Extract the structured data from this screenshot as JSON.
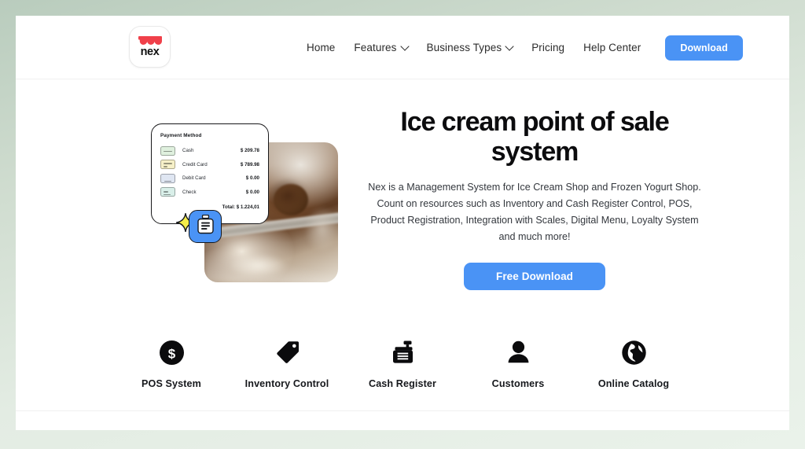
{
  "brand": {
    "logo_word": "nex",
    "logo_icon": "nex-crown-mark",
    "accent_blue": "#4a93f5",
    "logo_red": "#f0404a",
    "page_background": "#cfdccf"
  },
  "header": {
    "nav": [
      {
        "label": "Home",
        "icon": null
      },
      {
        "label": "Features",
        "icon": "chevron-down-icon"
      },
      {
        "label": "Business Types",
        "icon": "chevron-down-icon"
      },
      {
        "label": "Pricing",
        "icon": null
      },
      {
        "label": "Help Center",
        "icon": null
      }
    ],
    "download_label": "Download"
  },
  "hero": {
    "title": "Ice cream point of sale system",
    "description": "Nex is a Management System for Ice Cream Shop and Frozen Yogurt Shop. Count on resources such as Inventory and Cash Register Control, POS, Product Registration, Integration with Scales, Digital Menu, Loyalty System and much more!",
    "cta_label": "Free Download",
    "badge_icon": "receipt-printer-icon",
    "sparkle_icon": "sparkle-icon",
    "photo_alt": "chocolate-ice-cream-scoop-photo",
    "payment_card": {
      "title": "Payment Method",
      "rows": [
        {
          "icon": "cash-note-icon",
          "icon_color": "#dff0de",
          "label": "Cash",
          "amount": "$ 209.78"
        },
        {
          "icon": "credit-card-icon",
          "icon_color": "#f6f0c8",
          "label": "Credit Card",
          "amount": "$ 789.98"
        },
        {
          "icon": "debit-card-icon",
          "icon_color": "#dfe6f2",
          "label": "Debit Card",
          "amount": "$ 0.00"
        },
        {
          "icon": "check-icon",
          "icon_color": "#d9efe9",
          "label": "Check",
          "amount": "$ 0.00"
        }
      ],
      "total": "Total: $ 1.224,01"
    }
  },
  "features": [
    {
      "label": "POS System",
      "icon": "dollar-circle-icon"
    },
    {
      "label": "Inventory Control",
      "icon": "price-tag-icon"
    },
    {
      "label": "Cash Register",
      "icon": "cash-register-icon"
    },
    {
      "label": "Customers",
      "icon": "user-icon"
    },
    {
      "label": "Online Catalog",
      "icon": "globe-icon"
    }
  ]
}
